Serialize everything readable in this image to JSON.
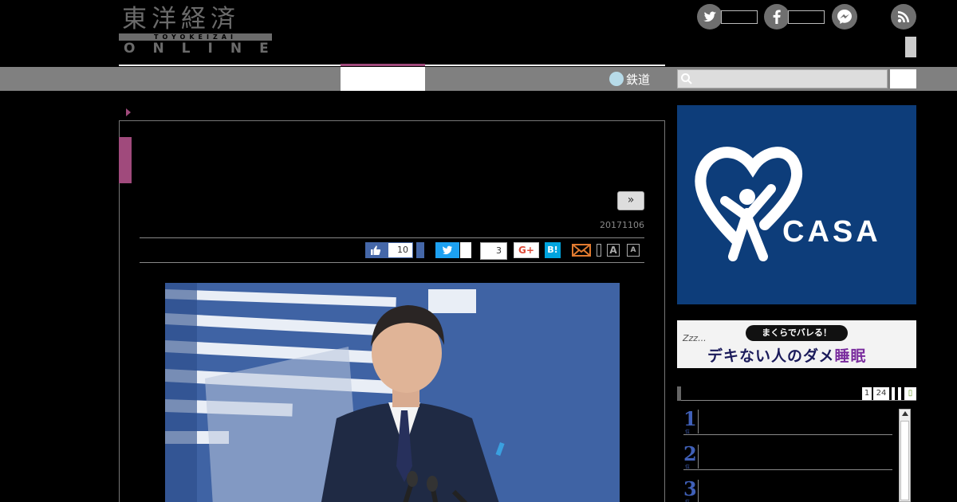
{
  "header": {
    "logo_kanji": "東洋経済",
    "logo_band": "TOYOKEIZAI",
    "logo_online": "ONLINE"
  },
  "sns": {
    "icons": [
      "twitter-icon",
      "facebook-icon",
      "messenger-icon",
      "rss-icon"
    ]
  },
  "nav": {
    "rail_label": "鉄道"
  },
  "search": {
    "placeholder": ""
  },
  "article": {
    "next_label": "»",
    "date": "20171106",
    "share": {
      "fb_like_count": "10",
      "hatena_count": "3",
      "gplus_label": "G+",
      "hatena_label": "B!",
      "font_large": "A",
      "font_small": "A"
    }
  },
  "ads": {
    "casa_text": "CASA",
    "sleep_pill": "まくらでバレる！",
    "sleep_zzz": "Zzz...",
    "sleep_main_a": "デキない人のダメ",
    "sleep_main_b": "睡眠"
  },
  "ranking": {
    "tabs": [
      "1",
      "24"
    ],
    "items": [
      {
        "rank": "1",
        "sub": "位"
      },
      {
        "rank": "2",
        "sub": "位"
      },
      {
        "rank": "3",
        "sub": "位"
      }
    ]
  },
  "colors": {
    "accent": "#a04a7c",
    "nav_gray": "#808080",
    "casa_blue": "#0d3d7a",
    "rank_blue": "#4060b8"
  }
}
